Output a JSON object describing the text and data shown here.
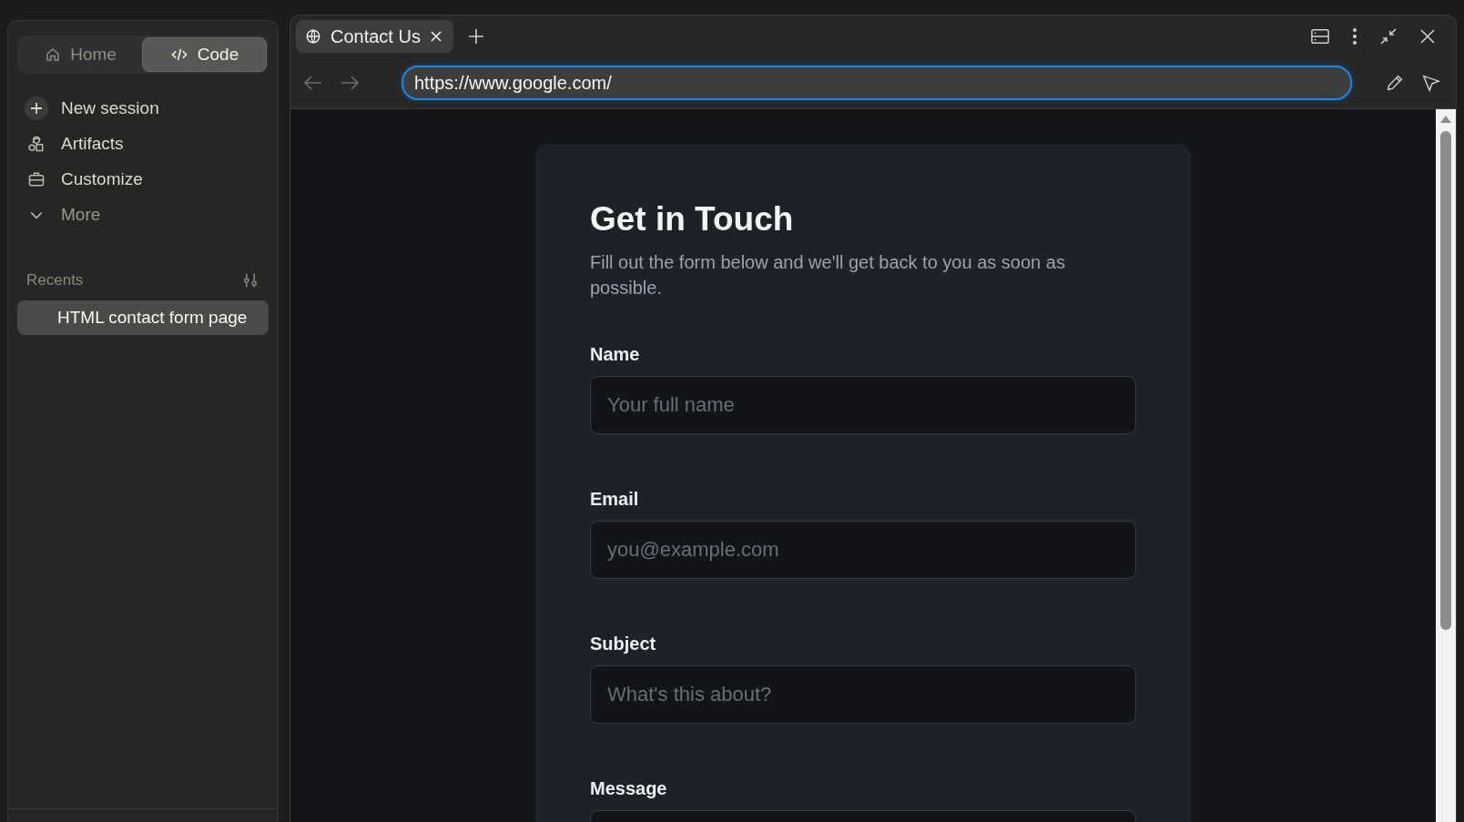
{
  "sidebar": {
    "modes": [
      {
        "label": "Home",
        "kind": "home",
        "selected": false
      },
      {
        "label": "Code",
        "kind": "code",
        "selected": true
      }
    ],
    "items": [
      {
        "label": "New session",
        "kind": "plus"
      },
      {
        "label": "Artifacts",
        "kind": "shapes"
      },
      {
        "label": "Customize",
        "kind": "briefcase"
      },
      {
        "label": "More",
        "kind": "chevron"
      }
    ],
    "recents_heading": "Recents",
    "recents": [
      {
        "label": "HTML contact form page",
        "selected": true
      }
    ]
  },
  "browser": {
    "tabs": [
      {
        "label": "Contact Us",
        "selected": true
      }
    ],
    "url": "https://www.google.com/"
  },
  "page": {
    "title": "Get in Touch",
    "subtitle": "Fill out the form below and we'll get back to you as soon as possible.",
    "fields": [
      {
        "label": "Name",
        "placeholder": "Your full name"
      },
      {
        "label": "Email",
        "placeholder": "you@example.com"
      },
      {
        "label": "Subject",
        "placeholder": "What's this about?"
      },
      {
        "label": "Message"
      }
    ]
  }
}
